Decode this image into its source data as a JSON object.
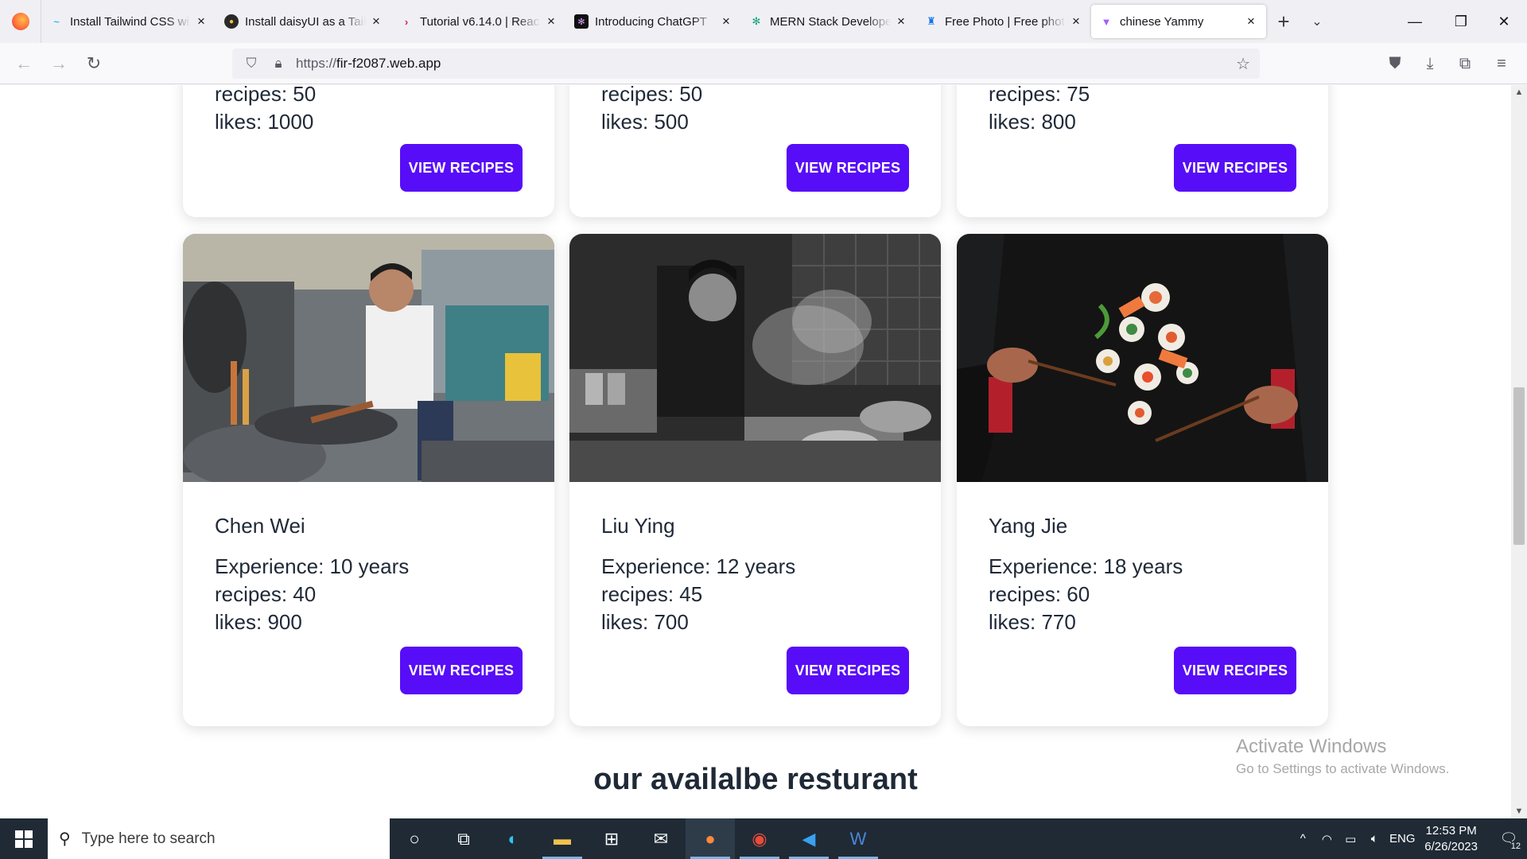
{
  "browser": {
    "tabs": [
      {
        "title": "Install Tailwind CSS wi",
        "icon": "tailwind-icon"
      },
      {
        "title": "Install daisyUI as a Tail",
        "icon": "daisyui-icon"
      },
      {
        "title": "Tutorial v6.14.0 | React",
        "icon": "react-router-icon"
      },
      {
        "title": "Introducing ChatGPT",
        "icon": "openai-icon"
      },
      {
        "title": "MERN Stack Develope",
        "icon": "chatgpt-icon"
      },
      {
        "title": "Free Photo | Free phot",
        "icon": "freepik-icon"
      },
      {
        "title": "chinese Yammy",
        "icon": "vite-icon"
      }
    ],
    "url_protocol": "https://",
    "url_host": "fir-f2087.web.app"
  },
  "top_cards": [
    {
      "recipes": "recipes: 50",
      "likes": "likes: 1000",
      "button": "VIEW RECIPES"
    },
    {
      "recipes": "recipes: 50",
      "likes": "likes: 500",
      "button": "VIEW RECIPES"
    },
    {
      "recipes": "recipes: 75",
      "likes": "likes: 800",
      "button": "VIEW RECIPES"
    }
  ],
  "chef_cards": [
    {
      "name": "Chen Wei",
      "experience": "Experience: 10 years",
      "recipes": "recipes: 40",
      "likes": "likes: 900",
      "button": "VIEW RECIPES"
    },
    {
      "name": "Liu Ying",
      "experience": "Experience: 12 years",
      "recipes": "recipes: 45",
      "likes": "likes: 700",
      "button": "VIEW RECIPES"
    },
    {
      "name": "Yang Jie",
      "experience": "Experience: 18 years",
      "recipes": "recipes: 60",
      "likes": "likes: 770",
      "button": "VIEW RECIPES"
    }
  ],
  "section_title": "our availalbe resturant",
  "watermark": {
    "line1": "Activate Windows",
    "line2": "Go to Settings to activate Windows."
  },
  "taskbar": {
    "search_placeholder": "Type here to search",
    "language": "ENG",
    "time": "12:53 PM",
    "date": "6/26/2023",
    "notification_count": "12"
  },
  "colors": {
    "accent": "#570df8",
    "text": "#1f2937"
  }
}
